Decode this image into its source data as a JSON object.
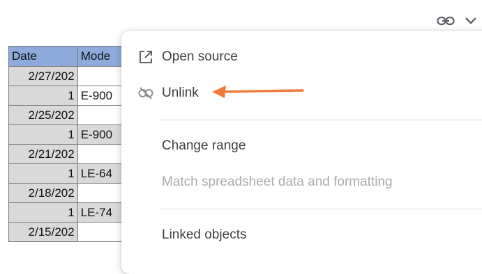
{
  "sheet": {
    "headers": [
      "Date",
      "Mode"
    ],
    "rows": [
      {
        "date": "2/27/202",
        "num": "1",
        "model": "E-900"
      },
      {
        "date": "2/25/202",
        "num": "1",
        "model": "E-900"
      },
      {
        "date": "2/21/202",
        "num": "1",
        "model": "LE-64"
      },
      {
        "date": "2/18/202",
        "num": "1",
        "model": "LE-74"
      },
      {
        "date": "2/15/202"
      }
    ]
  },
  "menu": {
    "items": [
      {
        "label": "Open source",
        "icon": "open-in-new-icon",
        "enabled": true
      },
      {
        "label": "Unlink",
        "icon": "link-off-icon",
        "enabled": true
      },
      {
        "label": "Change range",
        "enabled": true
      },
      {
        "label": "Match spreadsheet data and formatting",
        "enabled": false
      },
      {
        "label": "Linked objects",
        "enabled": true
      }
    ]
  },
  "colors": {
    "header_fill": "#8ea9db",
    "cell_fill": "#d9d9d9",
    "arrow": "#f07a3c",
    "disabled_text": "#a8abaf"
  }
}
